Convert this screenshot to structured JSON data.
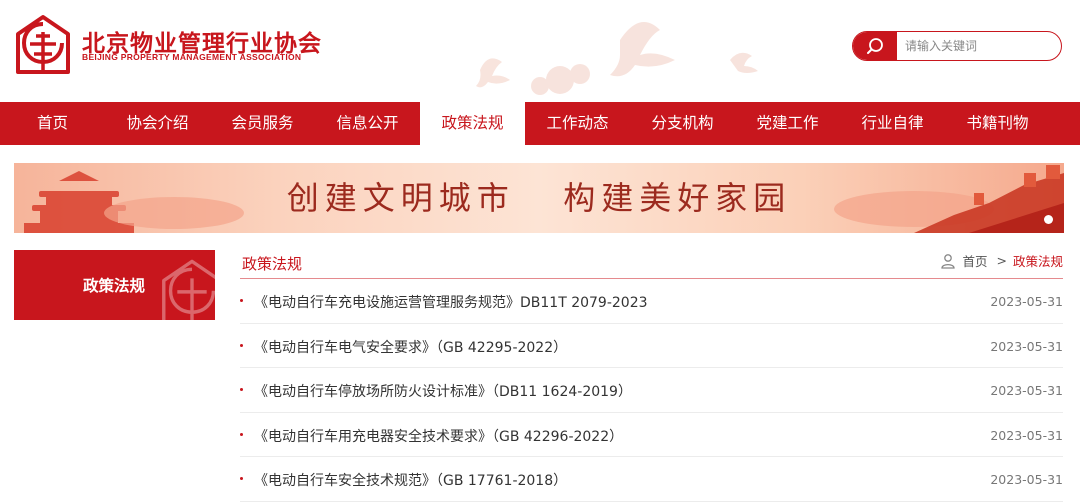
{
  "header": {
    "logo_cn": "北京物业管理行业协会",
    "logo_en": "BEIJING PROPERTY MANAGEMENT ASSOCIATION"
  },
  "search": {
    "placeholder": "请输入关键词",
    "icon": "search-icon"
  },
  "nav": {
    "items": [
      {
        "label": "首页"
      },
      {
        "label": "协会介绍"
      },
      {
        "label": "会员服务"
      },
      {
        "label": "信息公开"
      },
      {
        "label": "政策法规"
      },
      {
        "label": "工作动态"
      },
      {
        "label": "分支机构"
      },
      {
        "label": "党建工作"
      },
      {
        "label": "行业自律"
      },
      {
        "label": "书籍刊物"
      }
    ],
    "active_label": "政策法规"
  },
  "banner": {
    "slogan": "创建文明城市   构建美好家园"
  },
  "sidebar": {
    "title": "政策法规"
  },
  "main": {
    "title": "政策法规",
    "breadcrumb": {
      "home": "首页",
      "separator": ">",
      "current": "政策法规"
    },
    "items": [
      {
        "title": "《电动自行车充电设施运营管理服务规范》DB11T 2079-2023",
        "date": "2023-05-31"
      },
      {
        "title": "《电动自行车电气安全要求》（GB 42295-2022）",
        "date": "2023-05-31"
      },
      {
        "title": "《电动自行车停放场所防火设计标准》（DB11 1624-2019）",
        "date": "2023-05-31"
      },
      {
        "title": "《电动自行车用充电器安全技术要求》（GB 42296-2022）",
        "date": "2023-05-31"
      },
      {
        "title": "《电动自行车安全技术规范》（GB 17761-2018）",
        "date": "2023-05-31"
      }
    ]
  },
  "colors": {
    "brand_red": "#c8161d",
    "text": "#333333",
    "date": "#777777"
  }
}
